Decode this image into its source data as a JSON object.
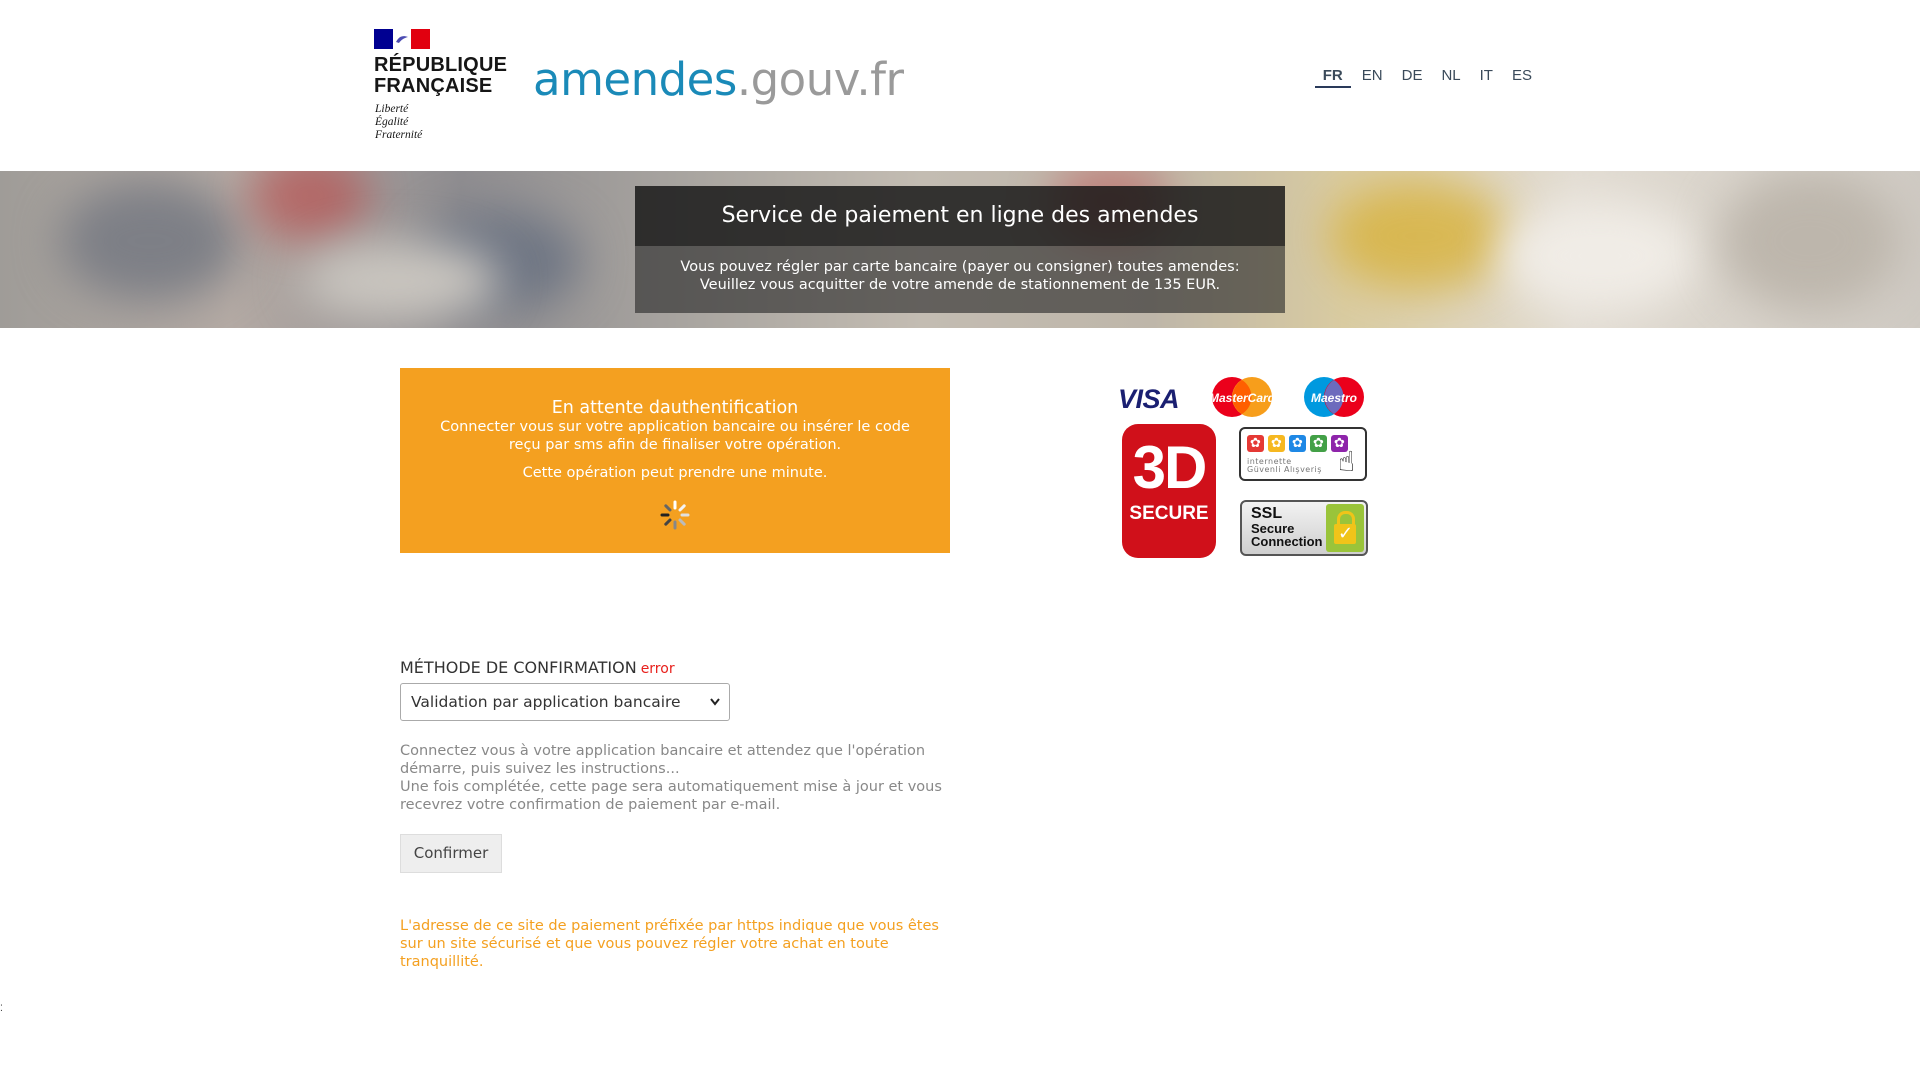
{
  "header": {
    "republic_line1": "RÉPUBLIQUE",
    "republic_line2": "FRANÇAISE",
    "motto_1": "Liberté",
    "motto_2": "Égalité",
    "motto_3": "Fraternité",
    "site_name_main": "amendes",
    "site_name_domain": ".gouv.fr",
    "languages": [
      "FR",
      "EN",
      "DE",
      "NL",
      "IT",
      "ES"
    ],
    "active_language": "FR"
  },
  "banner": {
    "title": "Service de paiement en ligne des amendes",
    "text": "Vous pouvez régler par carte bancaire (payer ou consigner) toutes amendes: Veuillez vous acquitter de votre amende de stationnement de 135 EUR."
  },
  "auth": {
    "title": "En attente dauthentification",
    "line": "Connecter vous sur votre application bancaire ou insérer le code reçu par sms afin de finaliser votre opération.",
    "wait": "Cette opération peut prendre une minute."
  },
  "payment_logos": {
    "visa": "VISA",
    "mastercard": "MasterCard",
    "maestro": "Maestro",
    "secure3d_big": "3D",
    "secure3d_small": "SECURE",
    "igal_line1": "internette",
    "igal_line2": "Güvenli Alışveriş",
    "ssl_1": "SSL",
    "ssl_2": "Secure",
    "ssl_3": "Connection"
  },
  "form": {
    "method_label": "MÉTHODE DE CONFIRMATION",
    "method_error": "error",
    "method_selected": "Validation par application bancaire",
    "instructions_1": "Connectez vous à votre application bancaire et attendez que l'opération démarre, puis suivez les instructions...",
    "instructions_2": "Une fois complétée, cette page sera automatiquement mise à jour et vous recevrez votre confirmation de paiement par e-mail.",
    "confirm_label": "Confirmer"
  },
  "security_note": "L'adresse de ce site de paiement préfixée par https indique que vous êtes sur un site sécurisé et que vous pouvez régler votre achat en toute tranquillité.",
  "colors": {
    "accent_orange": "#f4a020",
    "site_blue": "#1a8ab8",
    "error_red": "#e8201c"
  }
}
